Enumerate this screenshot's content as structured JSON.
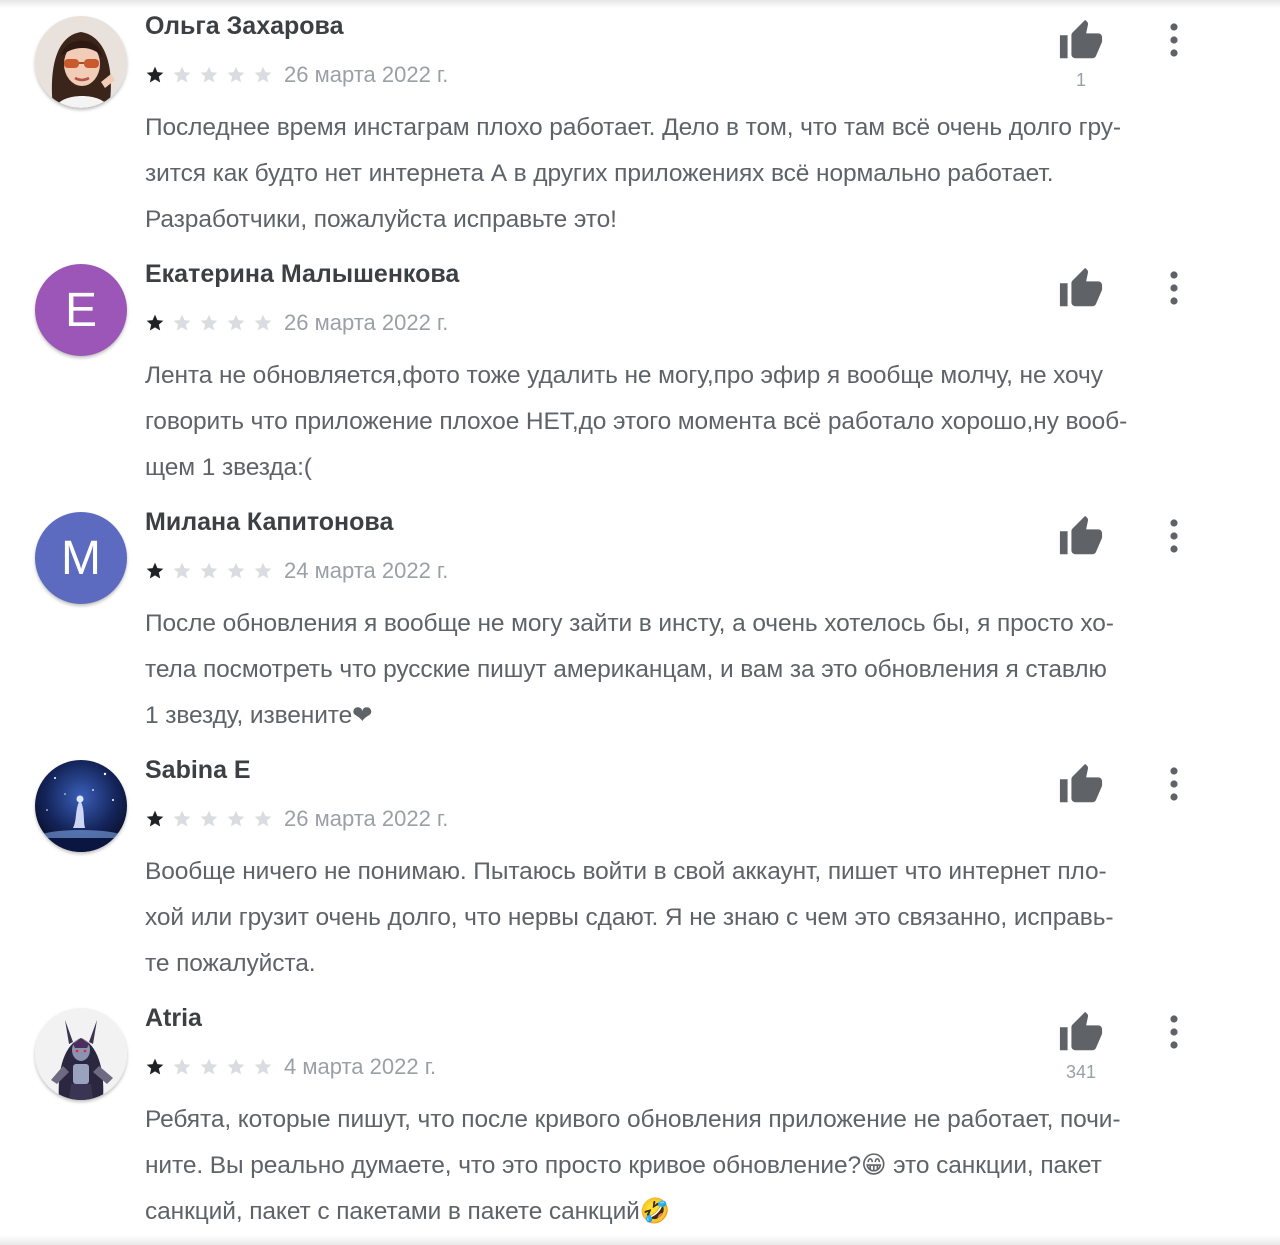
{
  "colors": {
    "star_filled": "#202124",
    "star_empty": "#dadce0",
    "icon": "#5f6368",
    "avatar_e": "#9c56b8",
    "avatar_m": "#5c6bc0"
  },
  "icons": {
    "like": "thumb-up-icon",
    "more": "more-vert-icon",
    "star": "star-icon"
  },
  "reviews": [
    {
      "author": "Ольга Захарова",
      "avatar_type": "photo",
      "rating": 1,
      "date": "26 марта 2022 г.",
      "likes": "1",
      "lines": [
        "Последнее время инстаграм плохо работает. Дело в том, что там всё очень долго гру-",
        "зится как будто нет интернета А в других приложениях всё нормально работает.",
        "Разработчики, пожалуйста исправьте это!"
      ]
    },
    {
      "author": "Екатерина Малышенкова",
      "avatar_type": "letter",
      "avatar_letter": "E",
      "rating": 1,
      "date": "26 марта 2022 г.",
      "likes": "",
      "lines": [
        "Лента не обновляется,фото тоже удалить не могу,про эфир я вообще молчу, не хочу",
        "говорить что приложение плохое НЕТ,до этого момента всё работало хорошо,ну вооб-",
        "щем 1 звезда:("
      ]
    },
    {
      "author": "Милана Капитонова",
      "avatar_type": "letter",
      "avatar_letter": "M",
      "rating": 1,
      "date": "24 марта 2022 г.",
      "likes": "",
      "lines": [
        "После обновления я вообще не могу зайти в инсту, а очень хотелось бы, я просто хо-",
        "тела посмотреть что русские пишут американцам, и вам за это обновления я ставлю",
        "1 звезду, извените❤"
      ]
    },
    {
      "author": "Sabina E",
      "avatar_type": "photo",
      "rating": 1,
      "date": "26 марта 2022 г.",
      "likes": "",
      "lines": [
        "Вообще ничего не понимаю. Пытаюсь войти в свой аккаунт, пишет что интернет пло-",
        "хой или грузит очень долго, что нервы сдают. Я не знаю с чем это связанно, исправь-",
        "те пожалуйста."
      ]
    },
    {
      "author": "Atria",
      "avatar_type": "photo",
      "rating": 1,
      "date": "4 марта 2022 г.",
      "likes": "341",
      "lines": [
        "Ребята, которые пишут, что после кривого обновления приложение не работает, почи-",
        "ните. Вы реально думаете, что это просто кривое обновление?😁 это санкции, пакет",
        "санкций, пакет с пакетами в пакете санкций🤣"
      ]
    }
  ]
}
